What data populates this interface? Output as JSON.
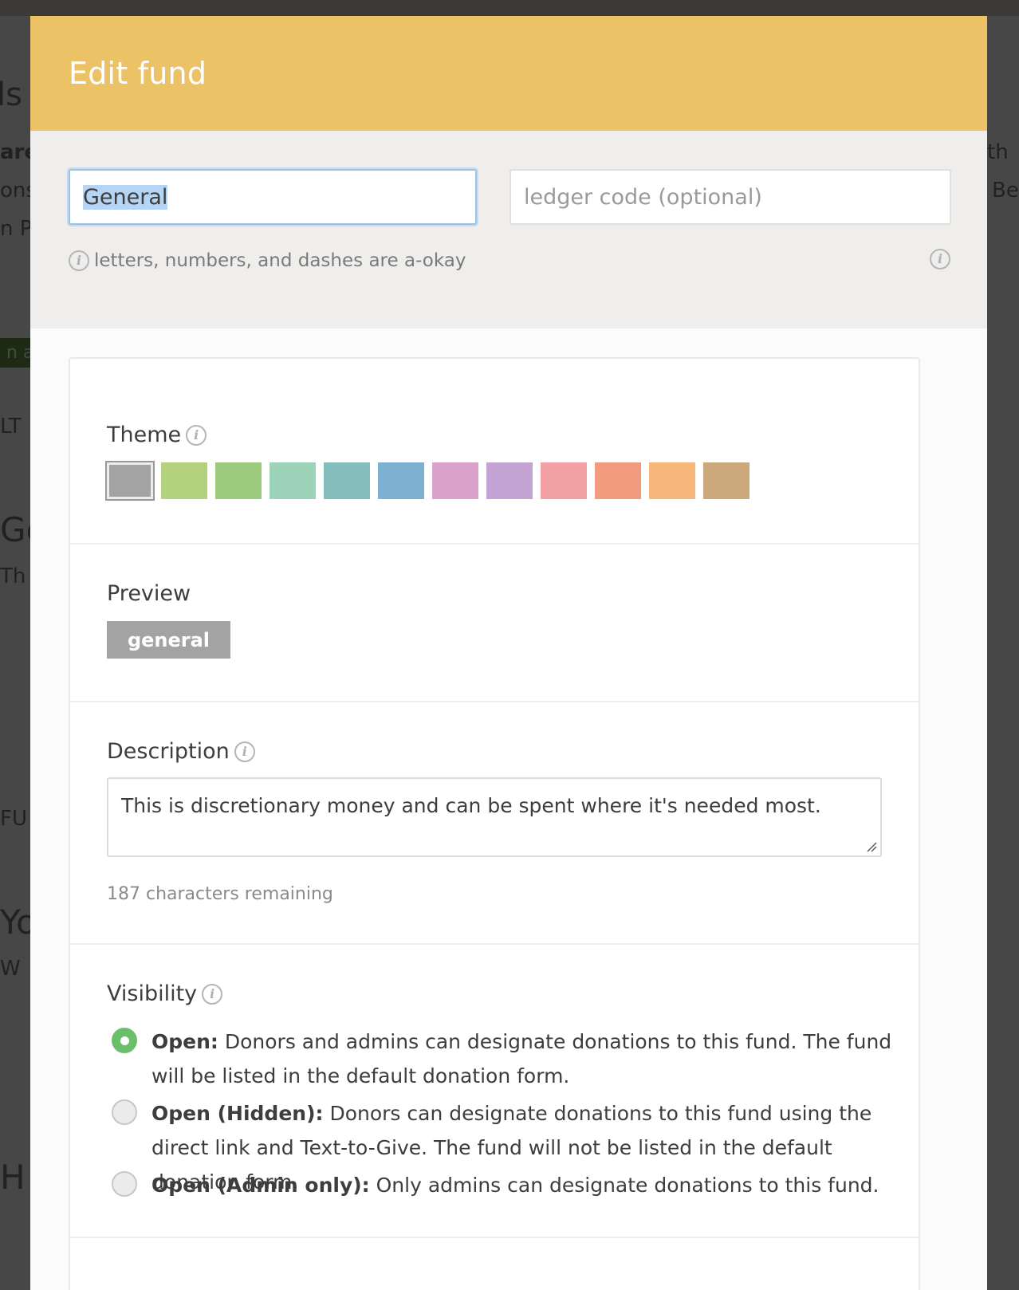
{
  "background": {
    "fragments": [
      "ls",
      "are",
      "ons",
      "n P",
      "n a",
      "LT",
      "Ge",
      "Th",
      "FU",
      "Yo",
      "W",
      "H",
      "th",
      "Be"
    ]
  },
  "modal": {
    "title": "Edit fund",
    "header_color": "#ecc266",
    "name_input": {
      "value": "General"
    },
    "ledger_input": {
      "placeholder": "ledger code (optional)"
    },
    "hint": "letters, numbers, and dashes are a-okay",
    "info_glyph": "i"
  },
  "theme": {
    "label": "Theme",
    "swatches": [
      {
        "color": "#a3a3a3",
        "selected": true
      },
      {
        "color": "#b4d27d"
      },
      {
        "color": "#9dcb7e"
      },
      {
        "color": "#9dd3b9"
      },
      {
        "color": "#85bcbc"
      },
      {
        "color": "#7eb0d2"
      },
      {
        "color": "#dba2cc"
      },
      {
        "color": "#c3a4d4"
      },
      {
        "color": "#f2a0a4"
      },
      {
        "color": "#f29b7e"
      },
      {
        "color": "#f8b77a"
      },
      {
        "color": "#cca97c"
      }
    ]
  },
  "preview": {
    "label": "Preview",
    "tag_text": "general",
    "tag_color": "#a3a3a3"
  },
  "description": {
    "label": "Description",
    "text": "This is discretionary money and can be spent where it's needed most.",
    "chars_remaining": "187 characters remaining"
  },
  "visibility": {
    "label": "Visibility",
    "options": [
      {
        "title": "Open:",
        "text": " Donors and admins can designate donations to this fund. The fund will be listed in the default donation form.",
        "checked": true
      },
      {
        "title": "Open (Hidden):",
        "text": " Donors can designate donations to this fund using the direct link and Text-to-Give. The fund will not be listed in the default donation form.",
        "checked": false
      },
      {
        "title": "Open (Admin only):",
        "text": " Only admins can designate donations to this fund.",
        "checked": false
      }
    ]
  }
}
